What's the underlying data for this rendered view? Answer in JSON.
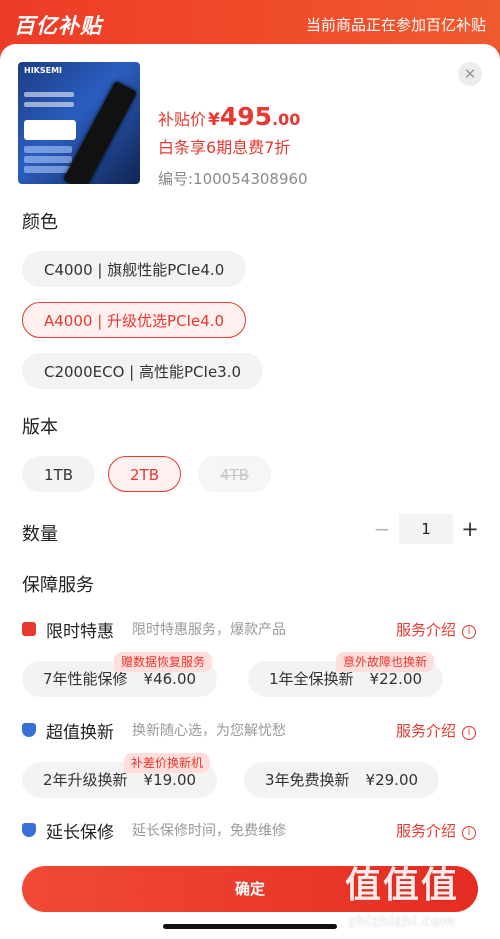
{
  "header": {
    "logo": "百亿补贴",
    "notice": "当前商品正在参加百亿补贴"
  },
  "product": {
    "price_label": "补贴价",
    "currency": "¥",
    "price_int": "495",
    "price_dec": ".00",
    "baitiao_offer": "白条享6期息费7折",
    "sku": "编号:100054308960",
    "image_brand": "HIKSEMI"
  },
  "close_icon": "close-icon",
  "color": {
    "title": "颜色",
    "options": [
      {
        "label": "C4000 | 旗舰性能PCIe4.0",
        "selected": false
      },
      {
        "label": "A4000 | 升级优选PCIe4.0",
        "selected": true
      },
      {
        "label": "C2000ECO | 高性能PCIe3.0",
        "selected": false
      }
    ]
  },
  "version": {
    "title": "版本",
    "options": [
      {
        "label": "1TB",
        "selected": false
      },
      {
        "label": "2TB",
        "selected": true
      },
      {
        "label": "4TB",
        "disabled": true
      }
    ]
  },
  "quantity": {
    "title": "数量",
    "minus": "−",
    "value": "1",
    "plus": "+"
  },
  "warranty": {
    "title": "保障服务",
    "groups": [
      {
        "name": "限时特惠",
        "desc": "限时特惠服务，爆款产品",
        "more": "服务介绍",
        "icon": "flash-sale-icon",
        "icon_color": "#e8382f",
        "items": [
          {
            "label": "7年性能保修",
            "price": "¥46.00",
            "badge": "赠数据恢复服务"
          },
          {
            "label": "1年全保换新",
            "price": "¥22.00",
            "badge": "意外故障也换新"
          }
        ]
      },
      {
        "name": "超值换新",
        "desc": "换新随心选，为您解忧愁",
        "more": "服务介绍",
        "icon": "shield-icon",
        "icon_color": "#3a6fd8",
        "items": [
          {
            "label": "2年升级换新",
            "price": "¥19.00",
            "badge": "补差价换新机"
          },
          {
            "label": "3年免费换新",
            "price": "¥29.00",
            "badge": ""
          }
        ]
      },
      {
        "name": "延长保修",
        "desc": "延长保修时间，免费维修",
        "more": "服务介绍",
        "icon": "warranty-shield-icon",
        "icon_color": "#3a6fd8",
        "items": []
      }
    ]
  },
  "confirm_label": "确定",
  "watermark": {
    "logo": "值值值",
    "domain": "zhizhizhi.com"
  }
}
